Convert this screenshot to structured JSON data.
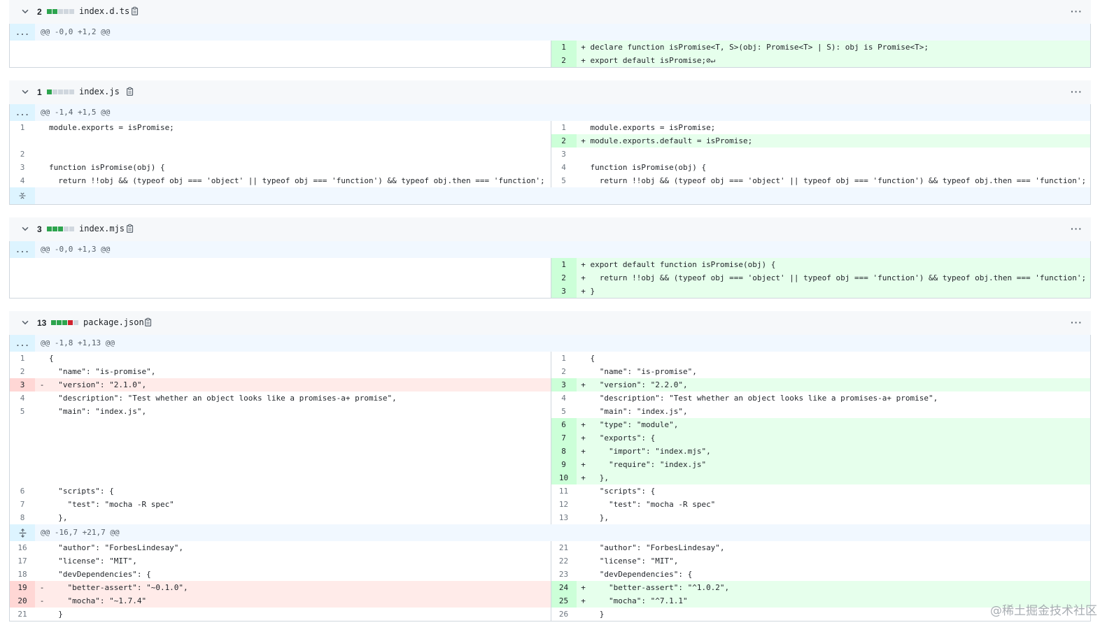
{
  "colors": {
    "add": "#e6ffec",
    "del": "#ffebe9",
    "hunk": "#f1f8ff",
    "accent_add": "#2da44e",
    "accent_del": "#cf222e"
  },
  "files": [
    {
      "count": "2",
      "blocks": [
        "add",
        "add",
        "neu",
        "neu",
        "neu"
      ],
      "name": "index.d.ts",
      "hunks": [
        {
          "header": "@@ -0,0 +1,2 @@",
          "rows": [
            {
              "l": null,
              "r": {
                "n": "1",
                "t": "add",
                "s": "+",
                "c": "declare function isPromise<T, S>(obj: Promise<T> | S): obj is Promise<T>;"
              }
            },
            {
              "l": null,
              "r": {
                "n": "2",
                "t": "add",
                "s": "+",
                "c": "export default isPromise;⊘↵"
              }
            }
          ]
        }
      ]
    },
    {
      "count": "1",
      "blocks": [
        "add",
        "neu",
        "neu",
        "neu",
        "neu"
      ],
      "name": "index.js",
      "hunks": [
        {
          "header": "@@ -1,4 +1,5 @@",
          "rows": [
            {
              "l": {
                "n": "1",
                "t": "ctx",
                "s": "",
                "c": "module.exports = isPromise;"
              },
              "r": {
                "n": "1",
                "t": "ctx",
                "s": "",
                "c": "module.exports = isPromise;"
              }
            },
            {
              "l": null,
              "r": {
                "n": "2",
                "t": "add",
                "s": "+",
                "c": "module.exports.default = isPromise;"
              }
            },
            {
              "l": {
                "n": "2",
                "t": "ctx",
                "s": "",
                "c": ""
              },
              "r": {
                "n": "3",
                "t": "ctx",
                "s": "",
                "c": ""
              }
            },
            {
              "l": {
                "n": "3",
                "t": "ctx",
                "s": "",
                "c": "function isPromise(obj) {"
              },
              "r": {
                "n": "4",
                "t": "ctx",
                "s": "",
                "c": "function isPromise(obj) {"
              }
            },
            {
              "l": {
                "n": "4",
                "t": "ctx",
                "s": "",
                "c": "  return !!obj && (typeof obj === 'object' || typeof obj === 'function') && typeof obj.then === 'function';"
              },
              "r": {
                "n": "5",
                "t": "ctx",
                "s": "",
                "c": "  return !!obj && (typeof obj === 'object' || typeof obj === 'function') && typeof obj.then === 'function';"
              }
            }
          ],
          "expand_after": true
        }
      ]
    },
    {
      "count": "3",
      "blocks": [
        "add",
        "add",
        "add",
        "neu",
        "neu"
      ],
      "name": "index.mjs",
      "hunks": [
        {
          "header": "@@ -0,0 +1,3 @@",
          "rows": [
            {
              "l": null,
              "r": {
                "n": "1",
                "t": "add",
                "s": "+",
                "c": "export default function isPromise(obj) {"
              }
            },
            {
              "l": null,
              "r": {
                "n": "2",
                "t": "add",
                "s": "+",
                "c": "  return !!obj && (typeof obj === 'object' || typeof obj === 'function') && typeof obj.then === 'function';"
              }
            },
            {
              "l": null,
              "r": {
                "n": "3",
                "t": "add",
                "s": "+",
                "c": "}"
              }
            }
          ]
        }
      ]
    },
    {
      "count": "13",
      "blocks": [
        "add",
        "add",
        "add",
        "del",
        "neu"
      ],
      "name": "package.json",
      "hunks": [
        {
          "header": "@@ -1,8 +1,13 @@",
          "rows": [
            {
              "l": {
                "n": "1",
                "t": "ctx",
                "s": "",
                "c": "{"
              },
              "r": {
                "n": "1",
                "t": "ctx",
                "s": "",
                "c": "{"
              }
            },
            {
              "l": {
                "n": "2",
                "t": "ctx",
                "s": "",
                "c": "  \"name\": \"is-promise\","
              },
              "r": {
                "n": "2",
                "t": "ctx",
                "s": "",
                "c": "  \"name\": \"is-promise\","
              }
            },
            {
              "l": {
                "n": "3",
                "t": "del",
                "s": "-",
                "c": "  \"version\": \"2.1.0\","
              },
              "r": {
                "n": "3",
                "t": "add",
                "s": "+",
                "c": "  \"version\": \"2.2.0\","
              }
            },
            {
              "l": {
                "n": "4",
                "t": "ctx",
                "s": "",
                "c": "  \"description\": \"Test whether an object looks like a promises-a+ promise\","
              },
              "r": {
                "n": "4",
                "t": "ctx",
                "s": "",
                "c": "  \"description\": \"Test whether an object looks like a promises-a+ promise\","
              }
            },
            {
              "l": {
                "n": "5",
                "t": "ctx",
                "s": "",
                "c": "  \"main\": \"index.js\","
              },
              "r": {
                "n": "5",
                "t": "ctx",
                "s": "",
                "c": "  \"main\": \"index.js\","
              }
            },
            {
              "l": null,
              "r": {
                "n": "6",
                "t": "add",
                "s": "+",
                "c": "  \"type\": \"module\","
              }
            },
            {
              "l": null,
              "r": {
                "n": "7",
                "t": "add",
                "s": "+",
                "c": "  \"exports\": {"
              }
            },
            {
              "l": null,
              "r": {
                "n": "8",
                "t": "add",
                "s": "+",
                "c": "    \"import\": \"index.mjs\","
              }
            },
            {
              "l": null,
              "r": {
                "n": "9",
                "t": "add",
                "s": "+",
                "c": "    \"require\": \"index.js\""
              }
            },
            {
              "l": null,
              "r": {
                "n": "10",
                "t": "add",
                "s": "+",
                "c": "  },"
              }
            },
            {
              "l": {
                "n": "6",
                "t": "ctx",
                "s": "",
                "c": "  \"scripts\": {"
              },
              "r": {
                "n": "11",
                "t": "ctx",
                "s": "",
                "c": "  \"scripts\": {"
              }
            },
            {
              "l": {
                "n": "7",
                "t": "ctx",
                "s": "",
                "c": "    \"test\": \"mocha -R spec\""
              },
              "r": {
                "n": "12",
                "t": "ctx",
                "s": "",
                "c": "    \"test\": \"mocha -R spec\""
              }
            },
            {
              "l": {
                "n": "8",
                "t": "ctx",
                "s": "",
                "c": "  },"
              },
              "r": {
                "n": "13",
                "t": "ctx",
                "s": "",
                "c": "  },"
              }
            }
          ]
        },
        {
          "header": "@@ -16,7 +21,7 @@",
          "expand_icon": true,
          "rows": [
            {
              "l": {
                "n": "16",
                "t": "ctx",
                "s": "",
                "c": "  \"author\": \"ForbesLindesay\","
              },
              "r": {
                "n": "21",
                "t": "ctx",
                "s": "",
                "c": "  \"author\": \"ForbesLindesay\","
              }
            },
            {
              "l": {
                "n": "17",
                "t": "ctx",
                "s": "",
                "c": "  \"license\": \"MIT\","
              },
              "r": {
                "n": "22",
                "t": "ctx",
                "s": "",
                "c": "  \"license\": \"MIT\","
              }
            },
            {
              "l": {
                "n": "18",
                "t": "ctx",
                "s": "",
                "c": "  \"devDependencies\": {"
              },
              "r": {
                "n": "23",
                "t": "ctx",
                "s": "",
                "c": "  \"devDependencies\": {"
              }
            },
            {
              "l": {
                "n": "19",
                "t": "del",
                "s": "-",
                "c": "    \"better-assert\": \"~0.1.0\","
              },
              "r": {
                "n": "24",
                "t": "add",
                "s": "+",
                "c": "    \"better-assert\": \"^1.0.2\","
              }
            },
            {
              "l": {
                "n": "20",
                "t": "del",
                "s": "-",
                "c": "    \"mocha\": \"~1.7.4\""
              },
              "r": {
                "n": "25",
                "t": "add",
                "s": "+",
                "c": "    \"mocha\": \"^7.1.1\""
              }
            },
            {
              "l": {
                "n": "21",
                "t": "ctx",
                "s": "",
                "c": "  }"
              },
              "r": {
                "n": "26",
                "t": "ctx",
                "s": "",
                "c": "  }"
              }
            }
          ]
        }
      ]
    }
  ],
  "watermark": "@稀土掘金技术社区"
}
